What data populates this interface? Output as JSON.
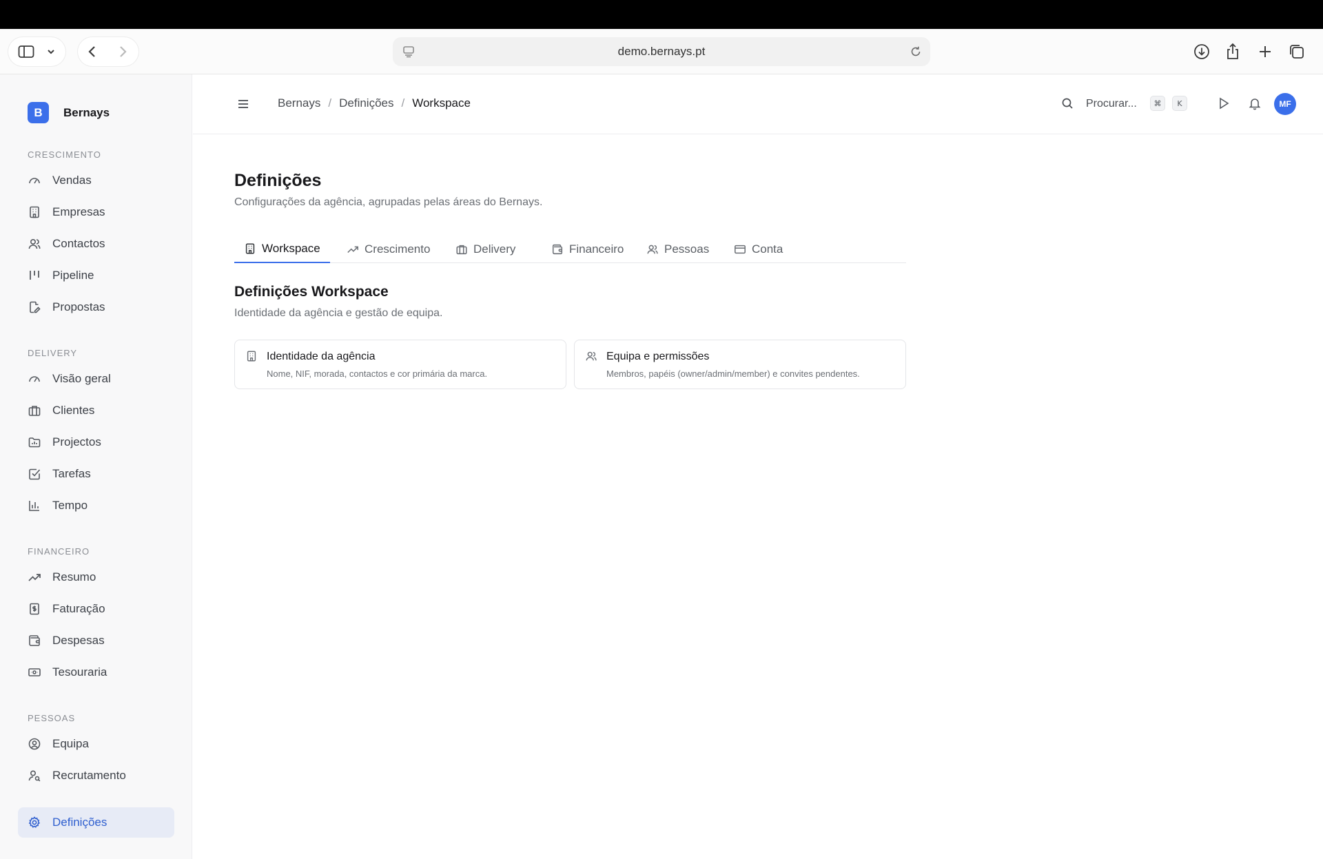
{
  "browser": {
    "url": "demo.bernays.pt"
  },
  "sidebar": {
    "brand_initial": "B",
    "brand_name": "Bernays",
    "sections": [
      {
        "title": "CRESCIMENTO",
        "items": [
          {
            "label": "Vendas",
            "icon": "gauge-icon"
          },
          {
            "label": "Empresas",
            "icon": "building-icon"
          },
          {
            "label": "Contactos",
            "icon": "users-icon"
          },
          {
            "label": "Pipeline",
            "icon": "kanban-icon"
          },
          {
            "label": "Propostas",
            "icon": "file-edit-icon"
          }
        ]
      },
      {
        "title": "DELIVERY",
        "items": [
          {
            "label": "Visão geral",
            "icon": "gauge-icon"
          },
          {
            "label": "Clientes",
            "icon": "briefcase-icon"
          },
          {
            "label": "Projectos",
            "icon": "folder-chart-icon"
          },
          {
            "label": "Tarefas",
            "icon": "check-square-icon"
          },
          {
            "label": "Tempo",
            "icon": "bar-chart-icon"
          }
        ]
      },
      {
        "title": "FINANCEIRO",
        "items": [
          {
            "label": "Resumo",
            "icon": "trending-up-icon"
          },
          {
            "label": "Faturação",
            "icon": "receipt-icon"
          },
          {
            "label": "Despesas",
            "icon": "wallet-icon"
          },
          {
            "label": "Tesouraria",
            "icon": "banknote-icon"
          }
        ]
      },
      {
        "title": "PESSOAS",
        "items": [
          {
            "label": "Equipa",
            "icon": "user-circle-icon"
          },
          {
            "label": "Recrutamento",
            "icon": "user-search-icon"
          }
        ]
      }
    ],
    "settings_label": "Definições"
  },
  "header": {
    "breadcrumbs": [
      "Bernays",
      "Definições",
      "Workspace"
    ],
    "search_placeholder": "Procurar...",
    "shortcut_keys": [
      "⌘",
      "K"
    ],
    "avatar_initials": "MF"
  },
  "main": {
    "title": "Definições",
    "subtitle": "Configurações da agência, agrupadas pelas áreas do Bernays.",
    "tabs": [
      {
        "label": "Workspace",
        "icon": "building-icon",
        "active": true
      },
      {
        "label": "Crescimento",
        "icon": "trending-up-icon",
        "active": false
      },
      {
        "label": "Delivery",
        "icon": "briefcase-icon",
        "active": false
      },
      {
        "label": "Financeiro",
        "icon": "wallet-icon",
        "active": false
      },
      {
        "label": "Pessoas",
        "icon": "users-icon",
        "active": false
      },
      {
        "label": "Conta",
        "icon": "credit-card-icon",
        "active": false
      }
    ],
    "section_title": "Definições Workspace",
    "section_subtitle": "Identidade da agência e gestão de equipa.",
    "cards": [
      {
        "title": "Identidade da agência",
        "description": "Nome, NIF, morada, contactos e cor primária da marca."
      },
      {
        "title": "Equipa e permissões",
        "description": "Membros, papéis (owner/admin/member) e convites pendentes."
      }
    ]
  },
  "colors": {
    "accent": "#3b6fea",
    "active_nav_bg": "#e7ebf6"
  }
}
